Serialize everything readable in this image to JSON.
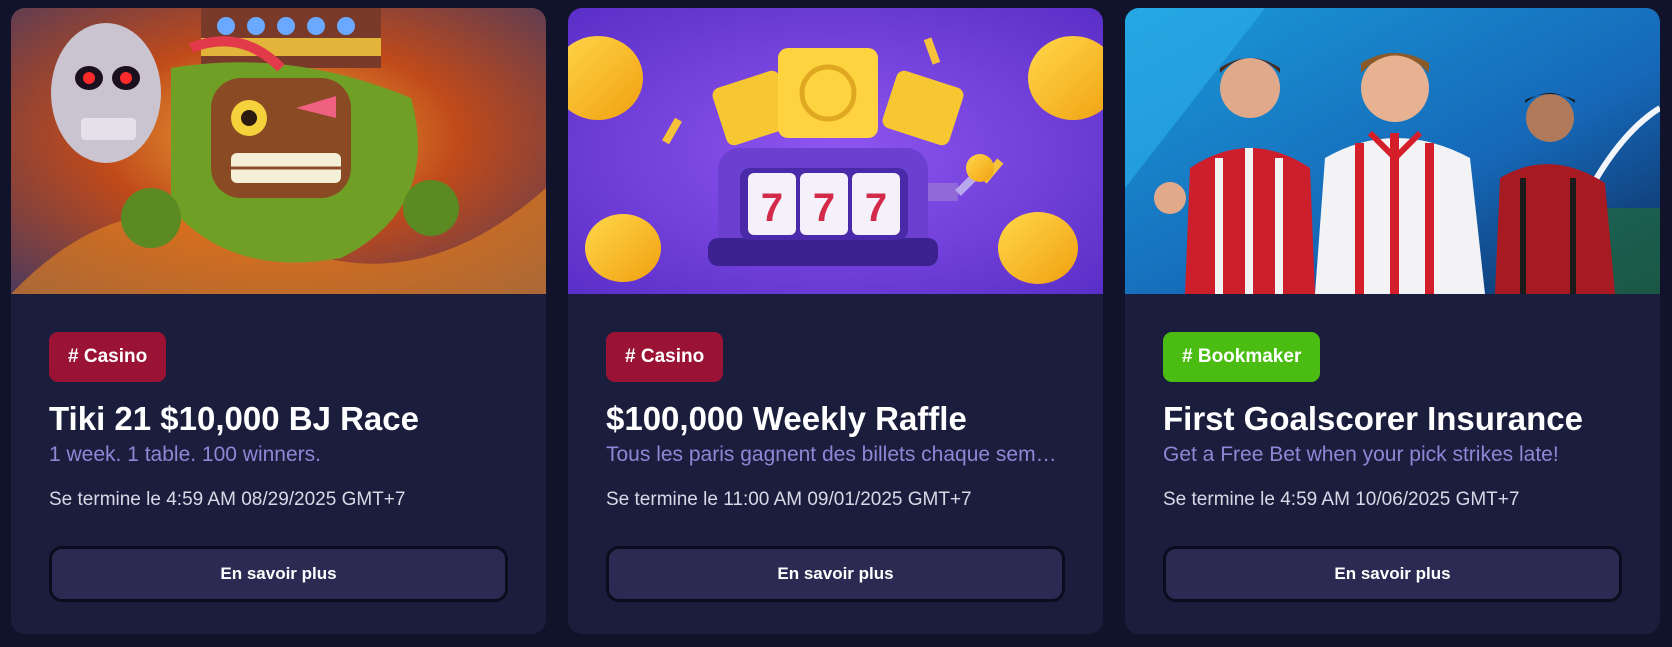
{
  "cards": [
    {
      "tag": "# Casino",
      "title": "Tiki 21 $10,000 BJ Race",
      "subtitle": "1 week. 1 table. 100 winners.",
      "ends": "Se termine le 4:59 AM 08/29/2025 GMT+7",
      "button": "En savoir plus",
      "image_icon": "tiki-skull-illustration",
      "tag_color": "#9a1335"
    },
    {
      "tag": "# Casino",
      "title": "$100,000 Weekly Raffle",
      "subtitle": "Tous les paris gagnent des billets chaque semaine pour le tirage",
      "ends": "Se termine le 11:00 AM 09/01/2025 GMT+7",
      "button": "En savoir plus",
      "image_icon": "slot-machine-777-illustration",
      "slot_text": "777",
      "tag_color": "#9a1335"
    },
    {
      "tag": "# Bookmaker",
      "title": "First Goalscorer Insurance",
      "subtitle": "Get a Free Bet when your pick strikes late!",
      "ends": "Se termine le 4:59 AM 10/06/2025 GMT+7",
      "button": "En savoir plus",
      "image_icon": "football-players-illustration",
      "tag_color": "#4bbd12"
    }
  ],
  "colors": {
    "page_bg": "#11132a",
    "card_bg": "#1b1d3d",
    "subtitle": "#8f86d6",
    "button_bg": "#2c2a52"
  }
}
